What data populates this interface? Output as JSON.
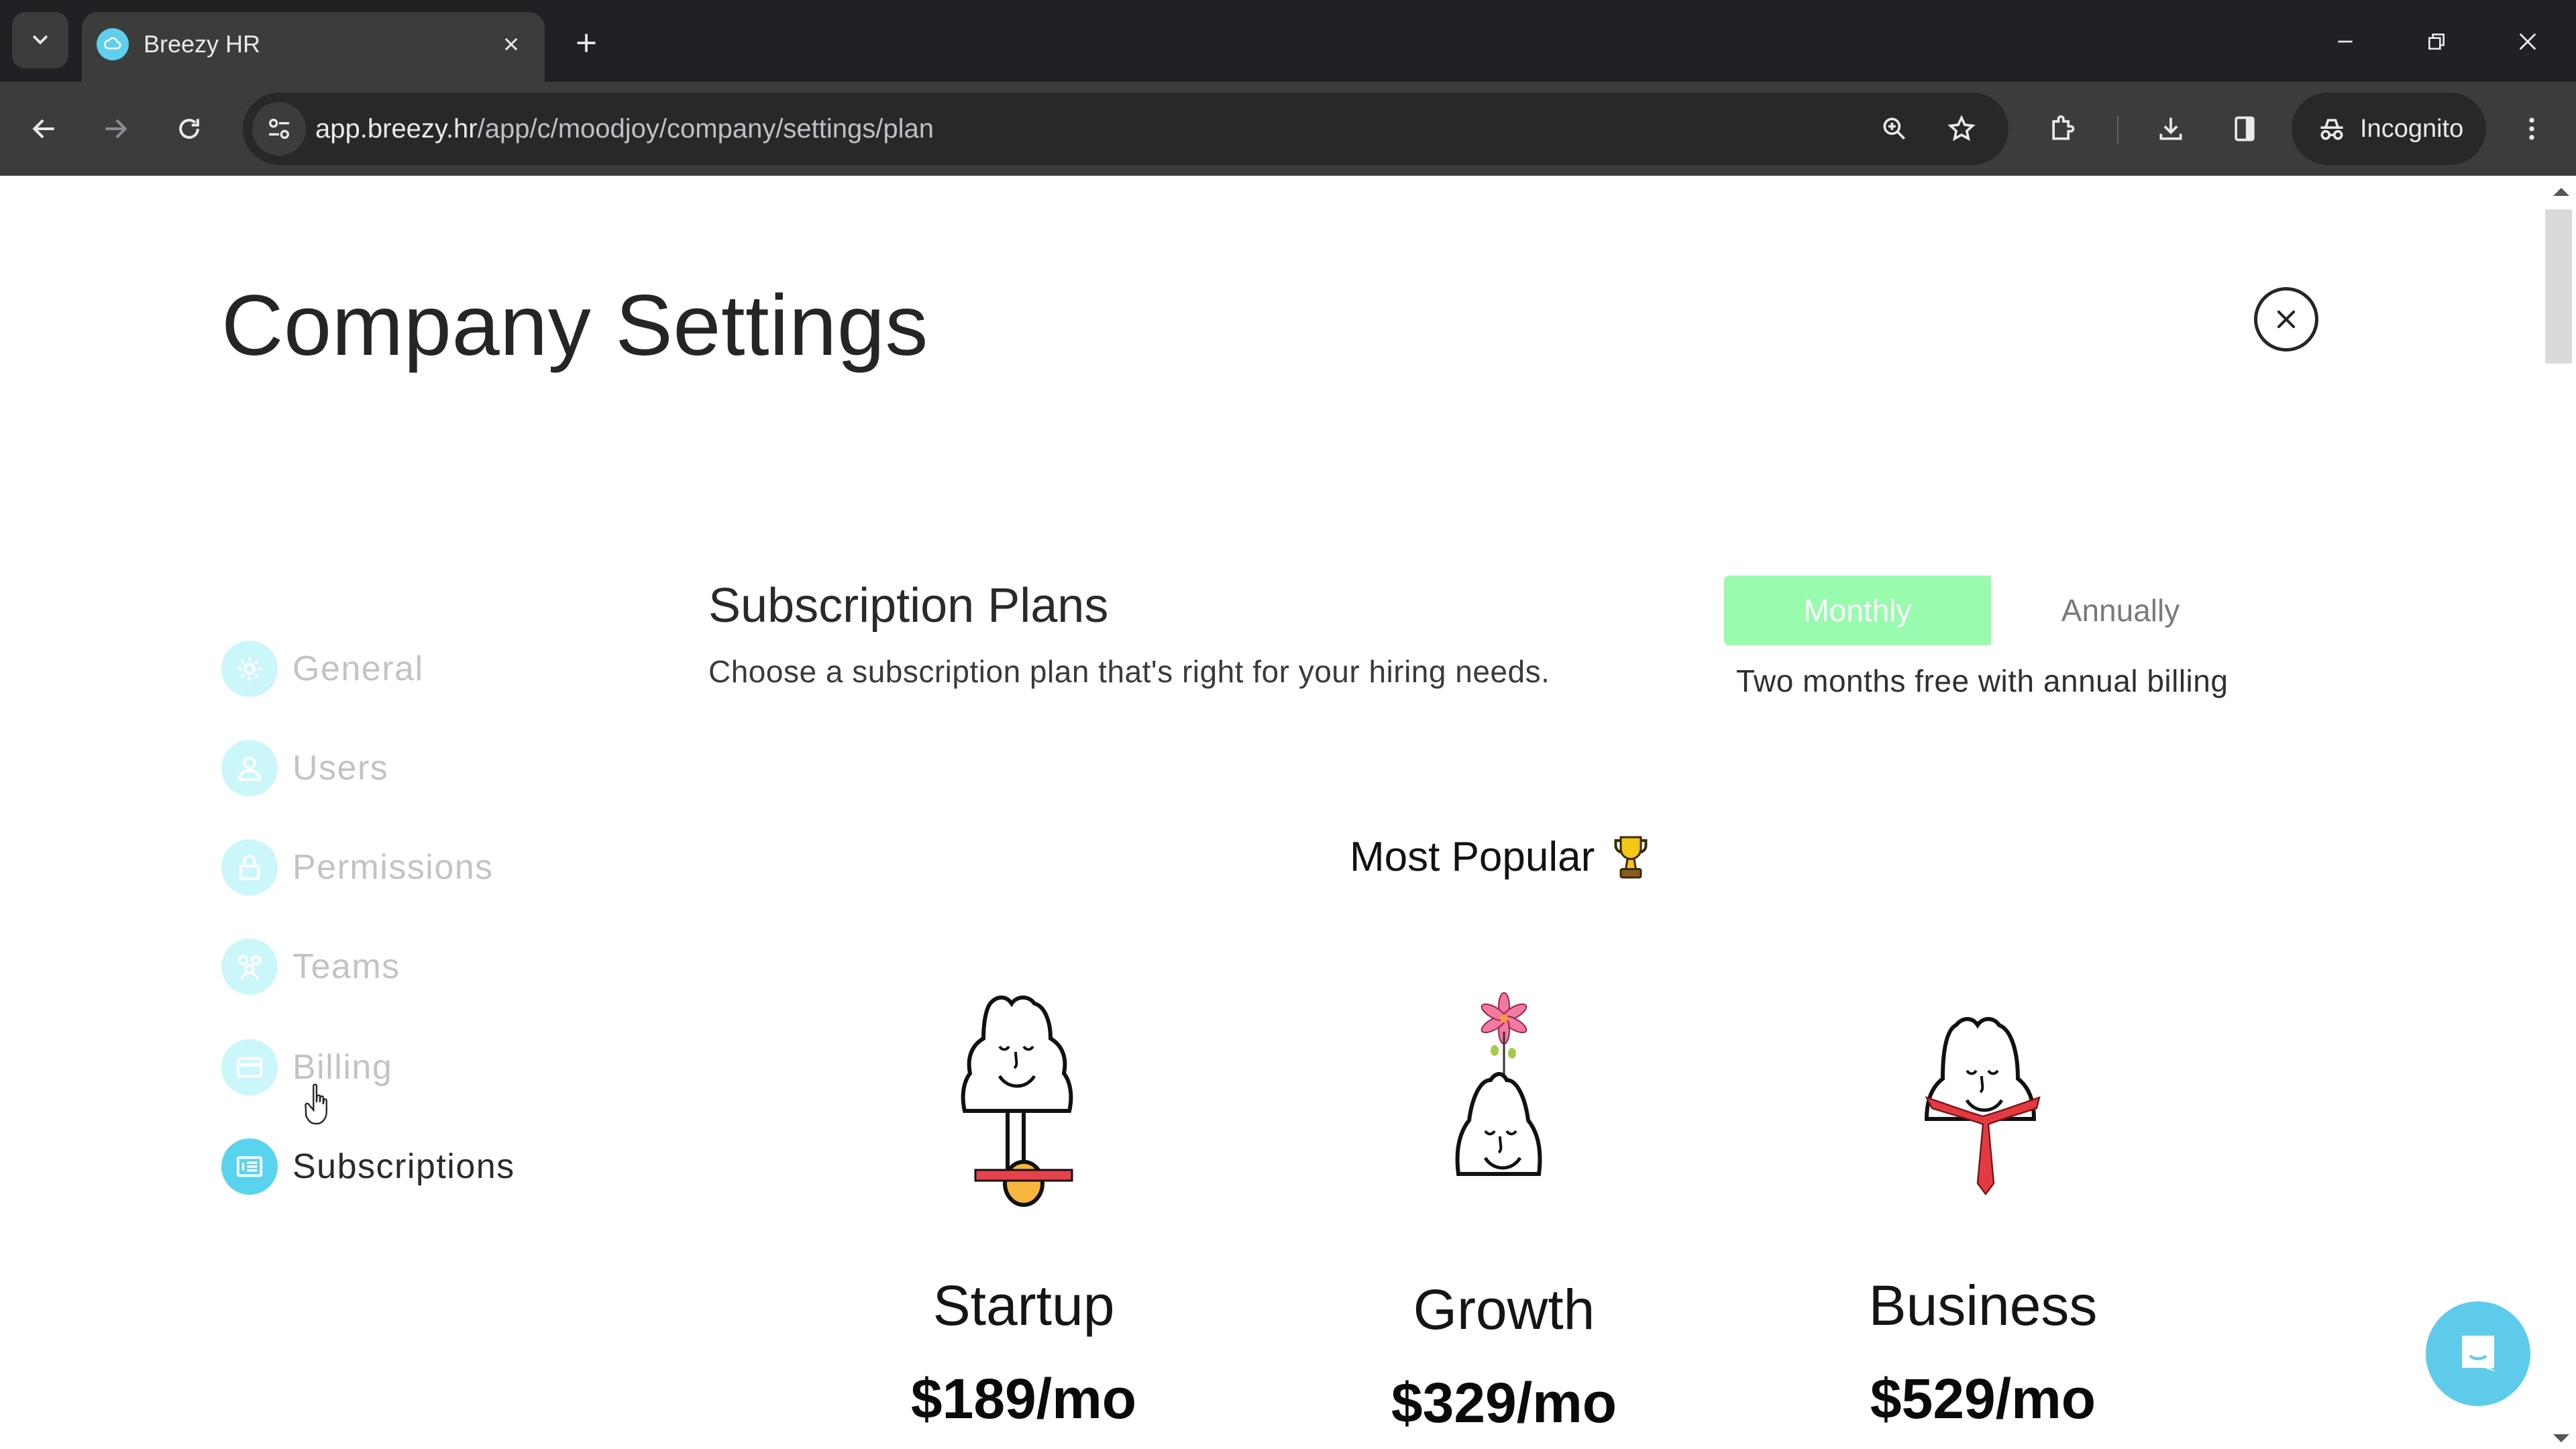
{
  "browser": {
    "tab_title": "Breezy HR",
    "url_host": "app.breezy.hr",
    "url_path": "/app/c/moodjoy/company/settings/plan",
    "incognito_label": "Incognito",
    "icons": {
      "tab_search": "chevron-down-icon",
      "favicon": "breezy-cloud-icon",
      "tab_close": "close-icon",
      "new_tab": "plus-icon",
      "back": "arrow-left-icon",
      "forward": "arrow-right-icon",
      "reload": "reload-icon",
      "site_info": "tune-icon",
      "zoom": "zoom-in-icon",
      "bookmark": "star-icon",
      "extensions": "puzzle-icon",
      "downloads": "download-icon",
      "side_panel": "side-panel-icon",
      "incognito": "incognito-icon",
      "menu": "more-vertical-icon",
      "minimize": "minimize-icon",
      "restore": "restore-icon",
      "close_window": "close-icon"
    }
  },
  "page": {
    "title": "Company Settings",
    "close_icon": "close-circle-icon"
  },
  "sidebar": {
    "items": [
      {
        "label": "General",
        "icon": "gear-icon",
        "active": false
      },
      {
        "label": "Users",
        "icon": "user-icon",
        "active": false
      },
      {
        "label": "Permissions",
        "icon": "lock-icon",
        "active": false
      },
      {
        "label": "Teams",
        "icon": "team-icon",
        "active": false
      },
      {
        "label": "Billing",
        "icon": "credit-card-icon",
        "active": false
      },
      {
        "label": "Subscriptions",
        "icon": "list-icon",
        "active": true
      }
    ]
  },
  "subscriptions": {
    "title": "Subscription Plans",
    "description": "Choose a subscription plan that's right for your hiring needs.",
    "billing_toggle": {
      "options": [
        "Monthly",
        "Annually"
      ],
      "selected": "Monthly",
      "note": "Two months free with annual billing"
    },
    "most_popular_label": "Most Popular",
    "most_popular_icon": "trophy-icon",
    "plans": [
      {
        "name": "Startup",
        "price": "$189/mo",
        "illustration": "cloud-unicycle-illustration"
      },
      {
        "name": "Growth",
        "price": "$329/mo",
        "illustration": "cloud-flower-illustration"
      },
      {
        "name": "Business",
        "price": "$529/mo",
        "illustration": "cloud-necktie-illustration"
      }
    ]
  },
  "colors": {
    "accent_cyan": "#5ad3ef",
    "toggle_active": "#98fbae",
    "inactive_text": "#c3c3c3"
  },
  "chat_widget_icon": "chat-icon"
}
